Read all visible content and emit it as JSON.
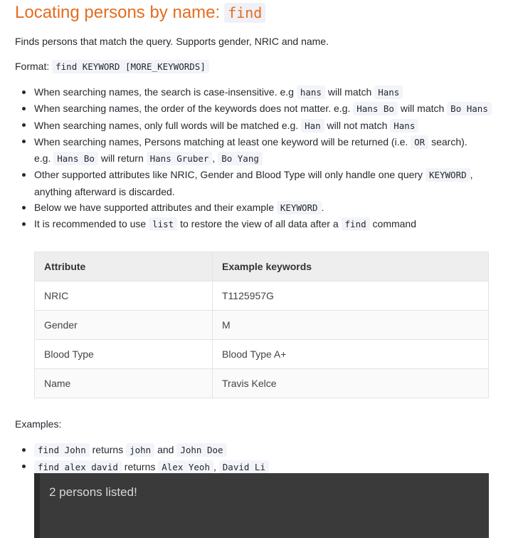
{
  "heading": {
    "text": "Locating persons by name:",
    "code": "find"
  },
  "intro": "Finds persons that match the query. Supports gender, NRIC and name.",
  "format": {
    "label": "Format:",
    "code": "find KEYWORD [MORE_KEYWORDS]"
  },
  "notes": [
    {
      "parts": [
        "When searching names, the search is case-insensitive. e.g ",
        "hans",
        " will match ",
        "Hans"
      ]
    },
    {
      "parts": [
        "When searching names, the order of the keywords does not matter. e.g. ",
        "Hans Bo",
        " will match ",
        "Bo Hans"
      ]
    },
    {
      "parts": [
        "When searching names, only full words will be matched e.g. ",
        "Han",
        " will not match ",
        "Hans"
      ]
    },
    {
      "parts": [
        "When searching names, Persons matching at least one keyword will be returned (i.e. ",
        "OR",
        " search).",
        "e.g. ",
        "Hans Bo",
        " will return ",
        "Hans Gruber",
        ", ",
        "Bo Yang"
      ]
    },
    {
      "parts": [
        "Other supported attributes like NRIC, Gender and Blood Type will only handle one query ",
        "KEYWORD",
        ",",
        "anything afterward is discarded."
      ]
    },
    {
      "parts": [
        "Below we have supported attributes and their example ",
        "KEYWORD",
        "."
      ]
    },
    {
      "parts": [
        "It is recommended to use ",
        "list",
        " to restore the view of all data after a ",
        "find",
        " command"
      ]
    }
  ],
  "table": {
    "headers": [
      "Attribute",
      "Example keywords"
    ],
    "rows": [
      [
        "NRIC",
        "T1125957G"
      ],
      [
        "Gender",
        "M"
      ],
      [
        "Blood Type",
        "Blood Type A+"
      ],
      [
        "Name",
        "Travis Kelce"
      ]
    ]
  },
  "examples_label": "Examples:",
  "examples": [
    {
      "parts": [
        "find John",
        " returns ",
        "john",
        " and ",
        "John Doe"
      ]
    },
    {
      "parts": [
        "find alex david",
        " returns ",
        "Alex Yeoh",
        ", ",
        "David Li"
      ]
    }
  ],
  "terminal": {
    "text": "2 persons listed!"
  },
  "colors": {
    "heading": "#e46c1f",
    "terminal_bg": "#3a3a3a",
    "code_bg": "#f3f4f9"
  }
}
